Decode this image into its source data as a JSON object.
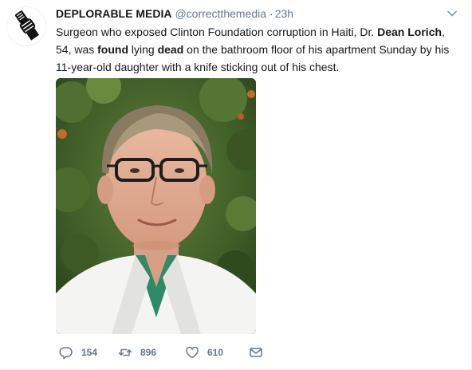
{
  "tweet": {
    "author_name": "DEPLORABLE MEDIA",
    "author_handle": "@correctthemedia",
    "separator": "·",
    "timestamp": "23h",
    "text_segments": [
      {
        "text": "Surgeon who exposed Clinton Foundation corruption in Haiti, Dr. ",
        "bold": false
      },
      {
        "text": "Dean Lorich",
        "bold": true
      },
      {
        "text": ", 54, was ",
        "bold": false
      },
      {
        "text": "found",
        "bold": true
      },
      {
        "text": " lying ",
        "bold": false
      },
      {
        "text": "dead",
        "bold": true
      },
      {
        "text": " on the bathroom floor of his apartment Sunday by his 11-year-old daughter with a knife sticking out of his chest.",
        "bold": false
      }
    ],
    "actions": {
      "reply_count": "154",
      "retweet_count": "896",
      "like_count": "610"
    }
  },
  "icons": {
    "avatar": "fist-holding-microphone-logo",
    "caret": "chevron-down-icon",
    "reply": "reply-icon",
    "retweet": "retweet-icon",
    "like": "heart-icon",
    "dm": "envelope-icon"
  },
  "colors": {
    "text_primary": "#14171a",
    "text_secondary": "#657786",
    "border": "#e6ecf0"
  }
}
